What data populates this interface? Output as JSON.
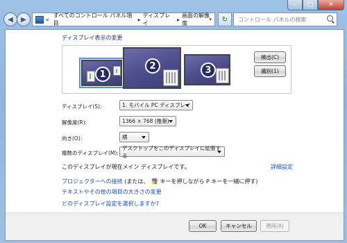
{
  "window": {
    "breadcrumb": [
      "すべてのコントロール パネル項目",
      "ディスプレイ",
      "画面の解像度"
    ],
    "breadcrumb_prefix": "«",
    "search_placeholder": "コントロール パネルの検索"
  },
  "main": {
    "heading": "ディスプレイ表示の変更",
    "monitors": [
      "1",
      "2",
      "3"
    ],
    "detect_button": "検出(C)",
    "identify_button": "識別(1)",
    "display_label": "ディスプレイ(S):",
    "display_value": "1. モバイル PC ディスプレイ",
    "resolution_label": "解像度(R):",
    "resolution_value": "1366 × 768 (推奨)",
    "orientation_label": "向き(O):",
    "orientation_value": "横",
    "multi_label": "複数のディスプレイ(M):",
    "multi_value": "デスクトップをこのディスプレイに拡張する",
    "main_display_note": "このディスプレイが現在メイン ディスプレイです。",
    "advanced_link": "詳細設定",
    "projector_link_a": "プロジェクターへの接続",
    "projector_link_b": "(または、",
    "projector_link_c": "キーを押しながら P キーを一緒に押す)",
    "text_size_link": "テキストやその他の項目の大きさの変更",
    "help_link": "どのディスプレイ設定を選択しますか?"
  },
  "footer": {
    "ok": "OK",
    "cancel": "キャンセル",
    "apply": "適用(A)"
  },
  "colors": {
    "link": "#1e4fa8",
    "heading": "#1e3287",
    "frame": "#9fc2e6"
  }
}
